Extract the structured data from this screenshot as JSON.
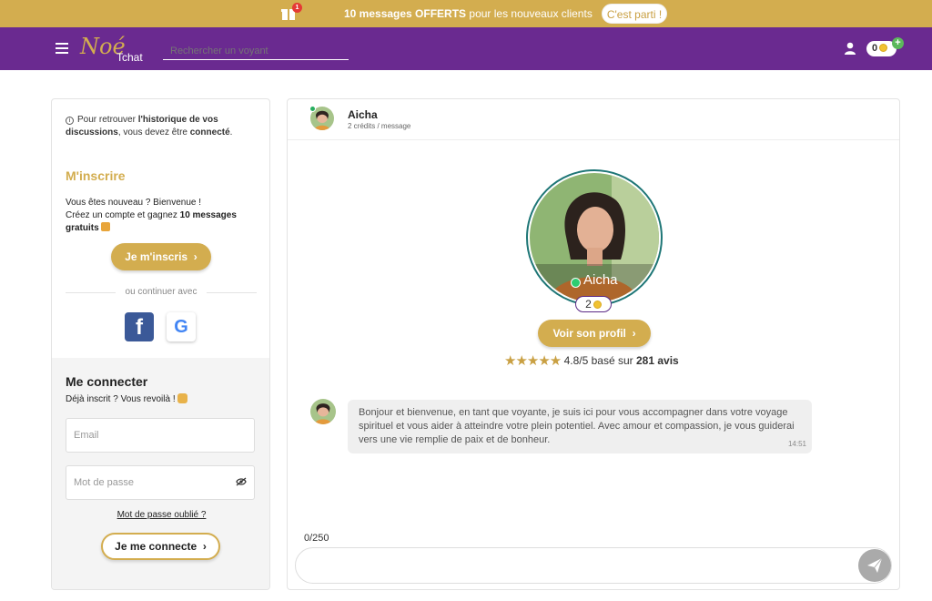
{
  "promo": {
    "badge": "1",
    "text_bold": "10 messages OFFERTS",
    "text_rest": " pour les nouveaux clients",
    "button": "C'est parti !"
  },
  "nav": {
    "logo_script": "Noé",
    "logo_word": "Tchat",
    "search_placeholder": "Rechercher un voyant",
    "credits": "0",
    "plus": "+",
    "icons": [
      "menu-icon",
      "user-icon",
      "coin-icon"
    ]
  },
  "left": {
    "info_pre": "Pour retrouver ",
    "info_bold": "l'historique de vos discussions",
    "info_mid": ", vous devez être ",
    "info_bold2": "connecté",
    "info_end": ".",
    "register_title": "M'inscrire",
    "welcome_line1": "Vous êtes nouveau ? Bienvenue !",
    "welcome_line2_pre": "Créez un compte et gagnez ",
    "welcome_line2_bold": "10 messages gratuits",
    "register_button": "Je m'inscris",
    "divider": "ou continuer avec",
    "login_title": "Me connecter",
    "login_sub": "Déjà inscrit ? Vous revoilà !",
    "email_placeholder": "Email",
    "password_placeholder": "Mot de passe",
    "forgot": "Mot de passe oublié ?",
    "login_button": "Je me connecte"
  },
  "chat": {
    "name": "Aicha",
    "rate": "2 crédits / message",
    "price": "2",
    "profile_button": "Voir son profil",
    "rating_value": "4.8/5 basé sur ",
    "rating_count": "281 avis",
    "stars": "★★★★★",
    "message": "Bonjour et bienvenue, en tant que voyante, je suis ici pour vous accompagner dans votre voyage spirituel et vous aider à atteindre votre plein potentiel. Avec amour et compassion, je vous guiderai vers une vie remplie de paix et de bonheur.",
    "message_time": "14:51",
    "counter": "0/250",
    "chevron": "›"
  },
  "colors": {
    "gold": "#d3ad4f",
    "purple": "#6a2a90",
    "online": "#2ecc71"
  }
}
